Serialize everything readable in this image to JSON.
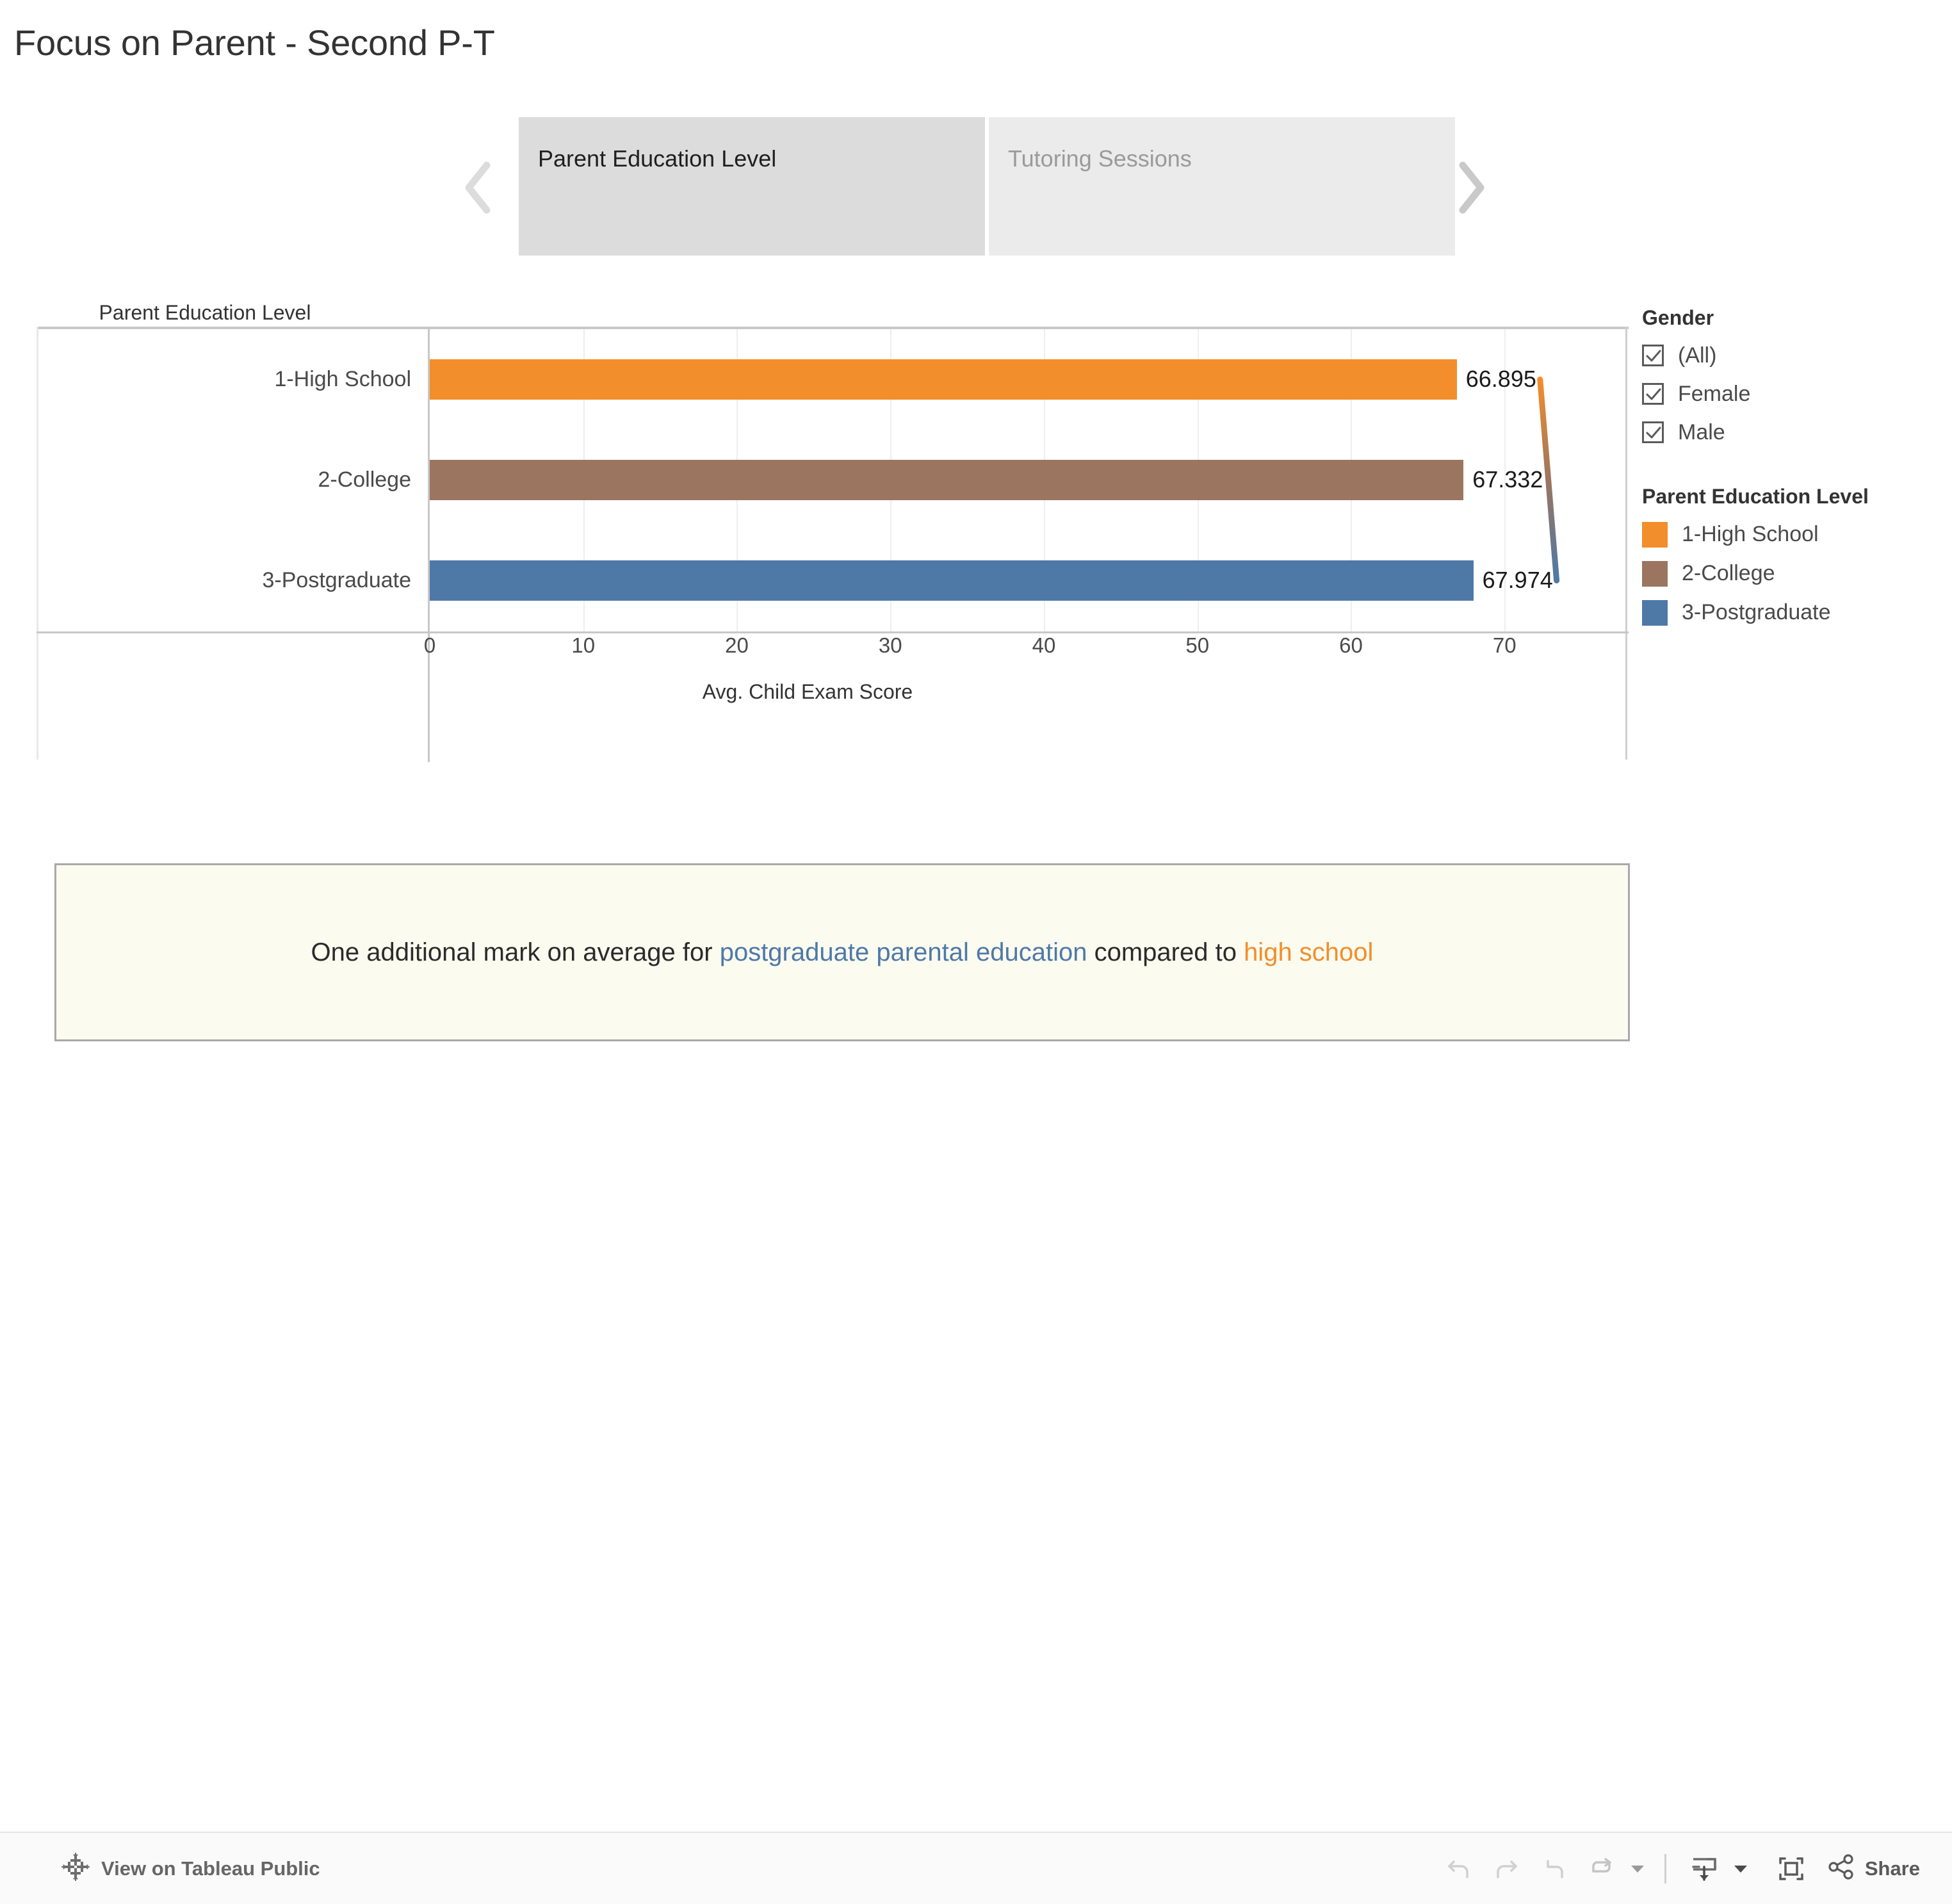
{
  "dashboard": {
    "title": "Focus on Parent - Second P-T"
  },
  "tab_nav": {
    "prev_icon": "chevron-left-icon",
    "next_icon": "chevron-right-icon",
    "tabs": [
      {
        "label": "Parent Education Level",
        "active": true
      },
      {
        "label": "Tutoring Sessions",
        "active": false
      }
    ]
  },
  "chart_data": {
    "type": "bar",
    "orientation": "horizontal",
    "title": "",
    "row_field_label": "Parent Education Level",
    "categories": [
      "1-High School",
      "2-College",
      "3-Postgraduate"
    ],
    "values": [
      66.895,
      67.332,
      67.974
    ],
    "value_labels": [
      "66.895",
      "67.332",
      "67.974"
    ],
    "colors": [
      "#f28e2b",
      "#9b7560",
      "#4e79a7"
    ],
    "xlabel": "Avg. Child Exam Score",
    "ylabel": "Parent Education Level",
    "xlim": [
      0,
      78
    ],
    "xticks": [
      0,
      10,
      20,
      30,
      40,
      50,
      60,
      70
    ],
    "xtick_labels": [
      "0",
      "10",
      "20",
      "30",
      "40",
      "50",
      "60",
      "70"
    ],
    "grid": true,
    "legend_position": "right",
    "reference_line": {
      "name": "trend-connector",
      "from_color": "#f28e2b",
      "to_color": "#4e79a7"
    }
  },
  "legend": {
    "gender": {
      "title": "Gender",
      "items": [
        {
          "label": "(All)",
          "checked": true
        },
        {
          "label": "Female",
          "checked": true
        },
        {
          "label": "Male",
          "checked": true
        }
      ]
    },
    "education": {
      "title": "Parent Education Level",
      "items": [
        {
          "label": "1-High School",
          "color": "#f28e2b"
        },
        {
          "label": "2-College",
          "color": "#9b7560"
        },
        {
          "label": "3-Postgraduate",
          "color": "#4e79a7"
        }
      ]
    }
  },
  "annotation": {
    "prefix": "One additional mark on average for ",
    "highlight_blue": "postgraduate parental education",
    "middle": " compared to ",
    "highlight_orange": "high school",
    "suffix": ""
  },
  "toolbar": {
    "tableau_link_label": "View on Tableau Public",
    "tableau_logo_icon": "tableau-logo-icon",
    "undo_icon": "undo-icon",
    "redo_icon": "redo-icon",
    "revert_icon": "revert-icon",
    "refresh_icon": "refresh-icon",
    "refresh_caret_icon": "caret-down-icon",
    "download_icon": "download-icon",
    "download_caret_icon": "caret-down-icon",
    "fullscreen_icon": "fullscreen-icon",
    "share_icon": "share-icon",
    "share_label": "Share"
  }
}
